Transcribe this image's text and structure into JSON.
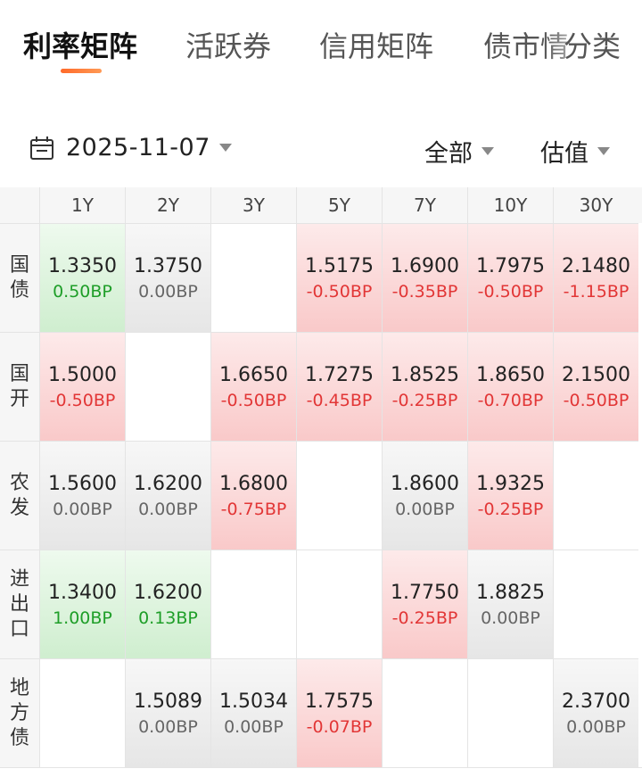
{
  "tabs": [
    {
      "label": "利率矩阵",
      "active": true
    },
    {
      "label": "活跃券",
      "active": false
    },
    {
      "label": "信用矩阵",
      "active": false
    },
    {
      "label": "债市情",
      "active": false
    },
    {
      "label": "分类",
      "active": false
    }
  ],
  "filters": {
    "date": "2025-11-07",
    "scope": "全部",
    "metric": "估值"
  },
  "matrix": {
    "columns": [
      "1Y",
      "2Y",
      "3Y",
      "5Y",
      "7Y",
      "10Y",
      "30Y"
    ],
    "rows": [
      {
        "label": [
          "国",
          "债"
        ],
        "cells": [
          {
            "value": "1.3350",
            "change": "0.50BP",
            "trend": "green"
          },
          {
            "value": "1.3750",
            "change": "0.00BP",
            "trend": "grey"
          },
          {
            "value": "",
            "change": "",
            "trend": "empty"
          },
          {
            "value": "1.5175",
            "change": "-0.50BP",
            "trend": "red"
          },
          {
            "value": "1.6900",
            "change": "-0.35BP",
            "trend": "red"
          },
          {
            "value": "1.7975",
            "change": "-0.50BP",
            "trend": "red"
          },
          {
            "value": "2.1480",
            "change": "-1.15BP",
            "trend": "red"
          }
        ]
      },
      {
        "label": [
          "国",
          "开"
        ],
        "cells": [
          {
            "value": "1.5000",
            "change": "-0.50BP",
            "trend": "red"
          },
          {
            "value": "",
            "change": "",
            "trend": "empty"
          },
          {
            "value": "1.6650",
            "change": "-0.50BP",
            "trend": "red"
          },
          {
            "value": "1.7275",
            "change": "-0.45BP",
            "trend": "red"
          },
          {
            "value": "1.8525",
            "change": "-0.25BP",
            "trend": "red"
          },
          {
            "value": "1.8650",
            "change": "-0.70BP",
            "trend": "red"
          },
          {
            "value": "2.1500",
            "change": "-0.50BP",
            "trend": "red"
          }
        ]
      },
      {
        "label": [
          "农",
          "发"
        ],
        "cells": [
          {
            "value": "1.5600",
            "change": "0.00BP",
            "trend": "grey"
          },
          {
            "value": "1.6200",
            "change": "0.00BP",
            "trend": "grey"
          },
          {
            "value": "1.6800",
            "change": "-0.75BP",
            "trend": "red"
          },
          {
            "value": "",
            "change": "",
            "trend": "empty"
          },
          {
            "value": "1.8600",
            "change": "0.00BP",
            "trend": "grey"
          },
          {
            "value": "1.9325",
            "change": "-0.25BP",
            "trend": "red"
          },
          {
            "value": "",
            "change": "",
            "trend": "empty"
          }
        ]
      },
      {
        "label": [
          "进",
          "出",
          "口"
        ],
        "cells": [
          {
            "value": "1.3400",
            "change": "1.00BP",
            "trend": "green"
          },
          {
            "value": "1.6200",
            "change": "0.13BP",
            "trend": "green"
          },
          {
            "value": "",
            "change": "",
            "trend": "empty"
          },
          {
            "value": "",
            "change": "",
            "trend": "empty"
          },
          {
            "value": "1.7750",
            "change": "-0.25BP",
            "trend": "red"
          },
          {
            "value": "1.8825",
            "change": "0.00BP",
            "trend": "grey"
          },
          {
            "value": "",
            "change": "",
            "trend": "empty"
          }
        ]
      },
      {
        "label": [
          "地",
          "方",
          "债"
        ],
        "cells": [
          {
            "value": "",
            "change": "",
            "trend": "empty"
          },
          {
            "value": "1.5089",
            "change": "0.00BP",
            "trend": "grey"
          },
          {
            "value": "1.5034",
            "change": "0.00BP",
            "trend": "grey"
          },
          {
            "value": "1.7575",
            "change": "-0.07BP",
            "trend": "red"
          },
          {
            "value": "",
            "change": "",
            "trend": "empty"
          },
          {
            "value": "",
            "change": "",
            "trend": "empty"
          },
          {
            "value": "2.3700",
            "change": "0.00BP",
            "trend": "grey"
          }
        ]
      }
    ]
  },
  "icons": {
    "date": "calendar-icon",
    "dropdown": "chevron-down-icon"
  },
  "colors": {
    "accent": "#ff6a2a",
    "up": "#1e9e28",
    "down": "#e23636",
    "flat": "#666666"
  }
}
